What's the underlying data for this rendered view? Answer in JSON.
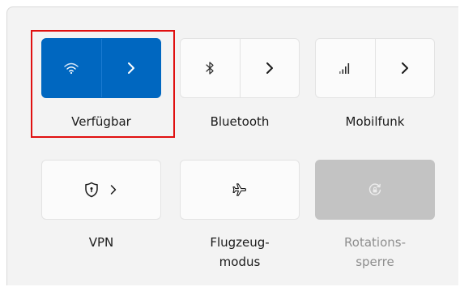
{
  "tiles": {
    "wifi": {
      "label": "Verfügbar",
      "state": "active",
      "icon": "wifi-icon",
      "expand_icon": "chevron-right-icon"
    },
    "bluetooth": {
      "label": "Bluetooth",
      "icon": "bluetooth-icon",
      "expand_icon": "chevron-right-icon"
    },
    "mobile": {
      "label": "Mobilfunk",
      "icon": "cellular-signal-icon",
      "expand_icon": "chevron-right-icon"
    },
    "vpn": {
      "label": "VPN",
      "icon": "shield-icon",
      "expand_icon": "chevron-right-icon"
    },
    "airplane": {
      "label_line1": "Flugzeug-",
      "label_line2": "modus",
      "icon": "airplane-icon"
    },
    "rotation": {
      "label_line1": "Rotations-",
      "label_line2": "sperre",
      "state": "disabled",
      "icon": "rotation-lock-icon"
    }
  },
  "colors": {
    "accent": "#0067c0",
    "highlight": "#e01010",
    "disabled_tile": "#c3c3c3"
  }
}
